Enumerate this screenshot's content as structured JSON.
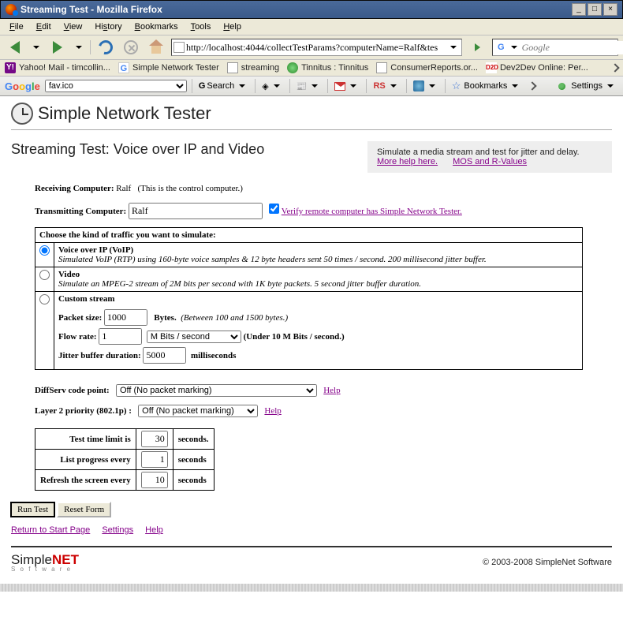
{
  "window": {
    "title": "Streaming Test - Mozilla Firefox"
  },
  "menu": {
    "file": "File",
    "edit": "Edit",
    "view": "View",
    "history": "History",
    "bookmarks": "Bookmarks",
    "tools": "Tools",
    "help": "Help"
  },
  "url": "http://localhost:4044/collectTestParams?computerName=Ralf&tes",
  "search_placeholder": "Google",
  "bookmarks": {
    "yahoo": "Yahoo! Mail - timcollin...",
    "snt": "Simple Network Tester",
    "streaming": "streaming",
    "tinnitus": "Tinnitus : Tinnitus",
    "consumer": "ConsumerReports.or...",
    "dev2dev": "Dev2Dev Online: Per..."
  },
  "googlebar": {
    "select_value": "fav.ico",
    "search": "Search",
    "bookmarks": "Bookmarks",
    "settings": "Settings"
  },
  "app_title": "Simple Network Tester",
  "page_title": "Streaming Test: Voice over IP and Video",
  "helpbox": {
    "text": "Simulate a media stream and test for jitter and delay.",
    "link1": "More help here.",
    "link2": "MOS and R-Values"
  },
  "recv": {
    "label": "Receiving Computer:",
    "value": "Ralf",
    "note": "(This is the control computer.)"
  },
  "tx": {
    "label": "Transmitting Computer:",
    "value": "Ralf",
    "verify": "Verify remote computer has Simple Network Tester."
  },
  "traffic": {
    "header": "Choose the kind of traffic you want to simulate:",
    "voip_title": "Voice over IP (VoIP)",
    "voip_desc": "Simulated VoIP (RTP) using 160-byte voice samples & 12 byte headers sent 50 times / second. 200 millisecond jitter buffer.",
    "video_title": "Video",
    "video_desc": "Simulate an MPEG-2 stream of 2M bits per second with 1K byte packets. 5 second jitter buffer duration.",
    "custom_title": "Custom stream",
    "packet_label": "Packet size:",
    "packet_value": "1000",
    "packet_unit": "Bytes.",
    "packet_hint": "(Between 100 and 1500 bytes.)",
    "flow_label": "Flow rate:",
    "flow_value": "1",
    "flow_unit_sel": "M Bits / second",
    "flow_hint": "(Under 10 M Bits / second.)",
    "jitter_label": "Jitter buffer duration:",
    "jitter_value": "5000",
    "jitter_unit": "milliseconds"
  },
  "diffserv": {
    "label": "DiffServ code point:",
    "value": "Off (No packet marking)",
    "help": "Help"
  },
  "layer2": {
    "label": "Layer 2 priority (802.1p) :",
    "value": "Off (No packet marking)",
    "help": "Help"
  },
  "timing": {
    "r1": {
      "label": "Test time limit is",
      "val": "30",
      "unit": "seconds."
    },
    "r2": {
      "label": "List progress every",
      "val": "1",
      "unit": "seconds"
    },
    "r3": {
      "label": "Refresh the screen every",
      "val": "10",
      "unit": "seconds"
    }
  },
  "buttons": {
    "run": "Run Test",
    "reset": "Reset Form"
  },
  "footer_links": {
    "return": "Return to Start Page",
    "settings": "Settings",
    "help": "Help"
  },
  "copyright": "© 2003-2008 SimpleNet Software"
}
